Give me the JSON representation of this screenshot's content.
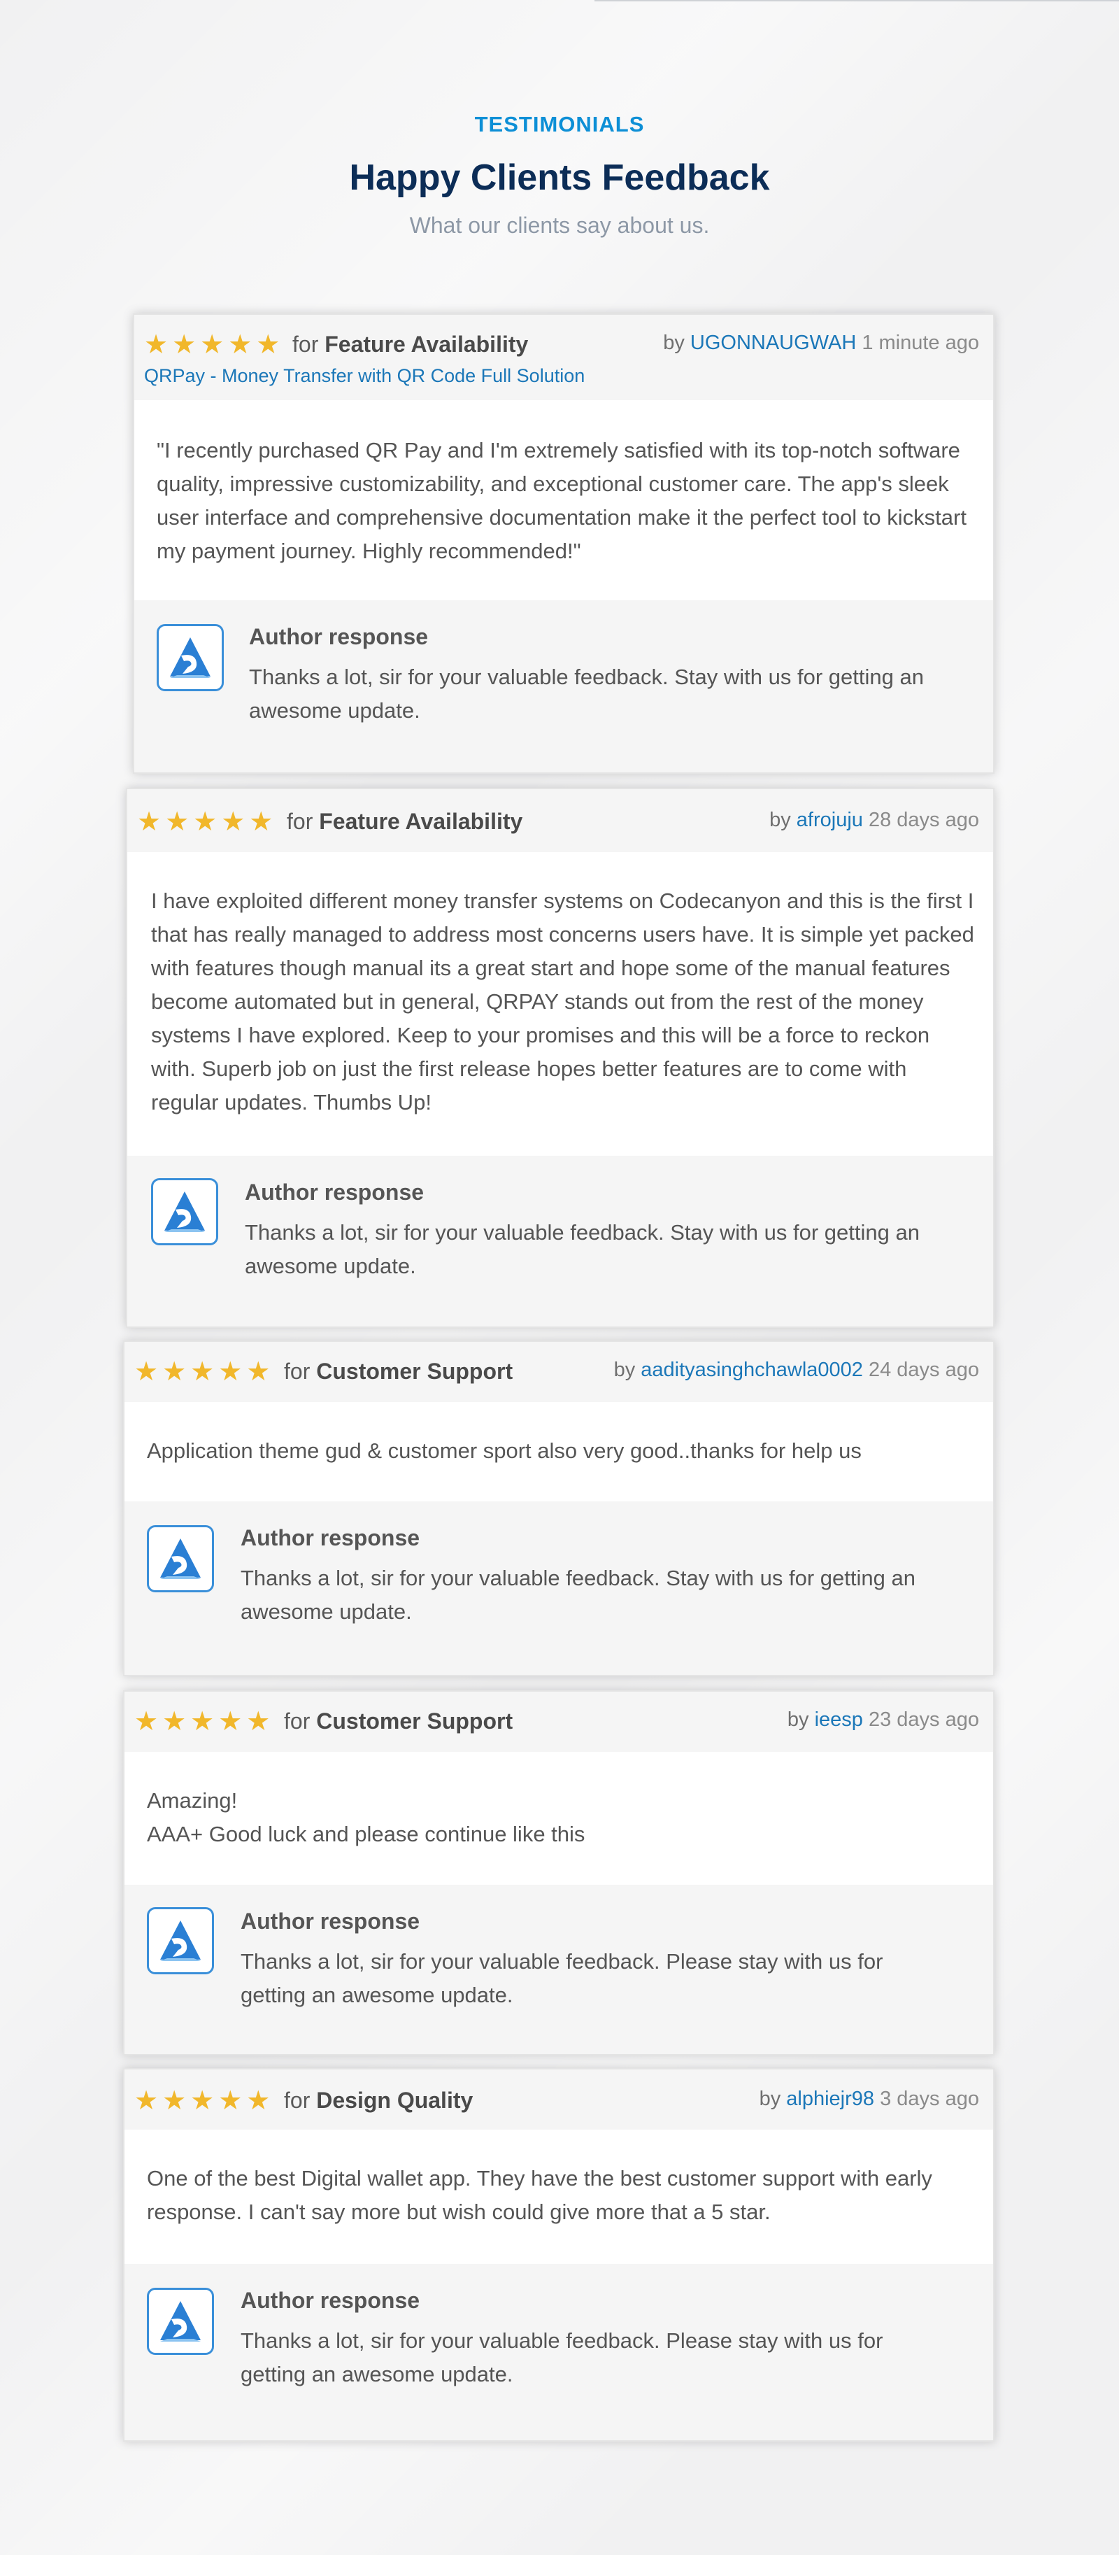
{
  "header": {
    "eyebrow": "TESTIMONIALS",
    "title": "Happy Clients Feedback",
    "subtitle": "What our clients say about us."
  },
  "reviews": [
    {
      "rating": 5,
      "stars": "★★★★★",
      "for_prefix": "for",
      "category": "Feature Availability",
      "by_prefix": "by",
      "username": "UGONNAUGWAH",
      "time": "1 minute ago",
      "product": "QRPay - Money Transfer with QR Code Full Solution",
      "text": "\"I recently purchased QR Pay and I'm extremely satisfied with its top-notch software quality, impressive customizability, and exceptional customer care. The app's sleek user interface and comprehensive documentation make it the perfect tool to kickstart my payment journey. Highly recommended!\"",
      "response_title": "Author response",
      "response_text": "Thanks a lot, sir for your valuable feedback. Stay with us for getting an awesome update.",
      "avatar_icon": "app-logo-icon"
    },
    {
      "rating": 5,
      "stars": "★★★★★",
      "for_prefix": "for",
      "category": "Feature Availability",
      "by_prefix": "by",
      "username": "afrojuju",
      "time": "28 days ago",
      "text": "I have exploited different money transfer systems on Codecanyon and this is the first I that has really managed to address most concerns users have. It is simple yet packed with features though manual its a great start and hope some of the manual features become automated but in general, QRPAY stands out from the rest of the money systems I have explored. Keep to your promises and this will be a force to reckon with. Superb job on just the first release hopes better features are to come with regular updates. Thumbs Up!",
      "response_title": "Author response",
      "response_text": "Thanks a lot, sir for your valuable feedback. Stay with us for getting an awesome update.",
      "avatar_icon": "app-logo-icon"
    },
    {
      "rating": 5,
      "stars": "★★★★★",
      "for_prefix": "for",
      "category": "Customer Support",
      "by_prefix": "by",
      "username": "aadityasinghchawla0002",
      "time": "24 days ago",
      "text": "Application theme gud & customer sport also very good..thanks for help us",
      "response_title": "Author response",
      "response_text": "Thanks a lot, sir for your valuable feedback. Stay with us for getting an awesome update.",
      "avatar_icon": "app-logo-icon"
    },
    {
      "rating": 5,
      "stars": "★★★★★",
      "for_prefix": "for",
      "category": "Customer Support",
      "by_prefix": "by",
      "username": "ieesp",
      "time": "23 days ago",
      "text_line1": "Amazing!",
      "text_line2": "AAA+ Good luck and please continue like this",
      "response_title": "Author response",
      "response_text": "Thanks a lot, sir for your valuable feedback. Please stay with us for getting an awesome update.",
      "avatar_icon": "app-logo-icon"
    },
    {
      "rating": 5,
      "stars": "★★★★★",
      "for_prefix": "for",
      "category": "Design Quality",
      "by_prefix": "by",
      "username": "alphiejr98",
      "time": "3 days ago",
      "text": "One of the best Digital wallet app. They have the best customer support with early response. I can't say more but wish could give more that a 5 star.",
      "response_title": "Author response",
      "response_text": "Thanks a lot, sir for your valuable feedback. Please stay with us for getting an awesome update.",
      "avatar_icon": "app-logo-icon"
    }
  ]
}
